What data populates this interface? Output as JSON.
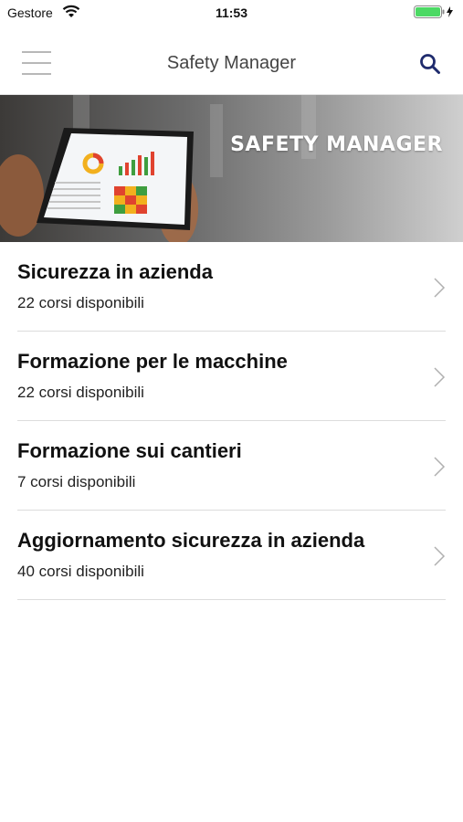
{
  "status_bar": {
    "carrier": "Gestore",
    "time": "11:53",
    "icons": [
      "wifi-icon",
      "battery-icon",
      "charging-icon"
    ],
    "battery_color": "#4cd964"
  },
  "header": {
    "title": "Safety Manager",
    "menu_icon": "hamburger-menu-icon",
    "search_icon": "search-icon",
    "accent_color": "#1f2b6d"
  },
  "banner": {
    "title": "SAFETY MANAGER"
  },
  "courses": [
    {
      "title": "Sicurezza in azienda",
      "subtitle": "22 corsi disponibili"
    },
    {
      "title": "Formazione per le macchine",
      "subtitle": "22 corsi disponibili"
    },
    {
      "title": "Formazione sui cantieri",
      "subtitle": "7 corsi disponibili"
    },
    {
      "title": "Aggiornamento sicurezza in azienda",
      "subtitle": "40 corsi disponibili"
    }
  ]
}
